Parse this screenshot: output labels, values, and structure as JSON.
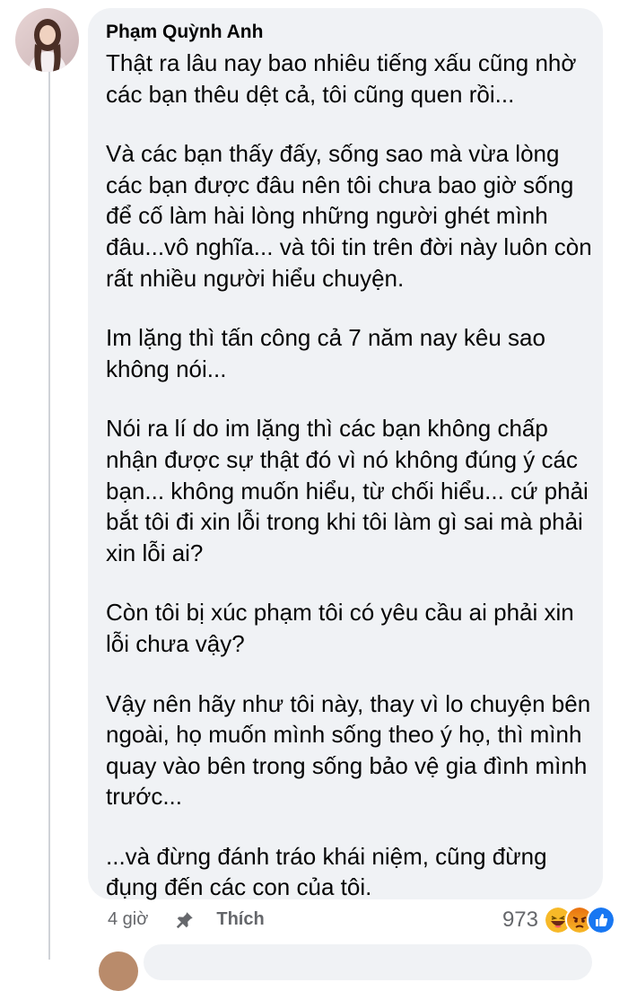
{
  "comment": {
    "author": "Phạm Quỳnh Anh",
    "paragraphs": [
      {
        "lines": [
          "Thật ra lâu nay bao nhiêu tiếng xấu cũng nhờ",
          "các bạn thêu dệt cả, tôi cũng quen rồi..."
        ]
      },
      {
        "lines": [
          "Và các bạn thấy đấy, sống sao mà vừa lòng",
          "các bạn được đâu nên tôi chưa bao giờ sống",
          "để cố làm hài lòng những người ghét mình",
          "đâu...vô nghĩa... và tôi tin trên đời này luôn còn",
          "rất nhiều người hiểu chuyện."
        ]
      },
      {
        "lines": [
          "Im lặng thì tấn công cả 7 năm nay kêu sao",
          "không nói..."
        ]
      },
      {
        "lines": [
          "Nói ra lí do im lặng thì các bạn không chấp",
          "nhận được sự thật đó vì nó không đúng ý các",
          "bạn... không muốn hiểu, từ chối hiểu... cứ phải",
          "bắt tôi đi xin lỗi trong khi tôi làm gì sai mà phải",
          "xin lỗi ai?"
        ]
      },
      {
        "lines": [
          "Còn tôi bị xúc phạm tôi có yêu cầu ai phải xin",
          "lỗi chưa vậy?"
        ]
      },
      {
        "lines": [
          "Vậy nên hãy như tôi này, thay vì lo chuyện bên",
          "ngoài, họ muốn mình sống theo ý họ, thì mình",
          "quay vào bên trong sống bảo vệ gia đình mình",
          "trước..."
        ]
      },
      {
        "lines": [
          "...và đừng đánh tráo khái niệm, cũng đừng",
          "đụng đến các con của tôi."
        ]
      }
    ]
  },
  "actions": {
    "time": "4 giờ",
    "like_label": "Thích",
    "pin_icon": "pin-icon"
  },
  "reactions": {
    "count": "973",
    "icons": [
      "haha-icon",
      "angry-icon",
      "like-icon"
    ]
  },
  "colors": {
    "bubble_bg": "#f0f2f5",
    "meta_text": "#65676b",
    "like_blue": "#1877f2",
    "haha_yellow": "#f7b928",
    "angry_orange": "#e9710f"
  }
}
